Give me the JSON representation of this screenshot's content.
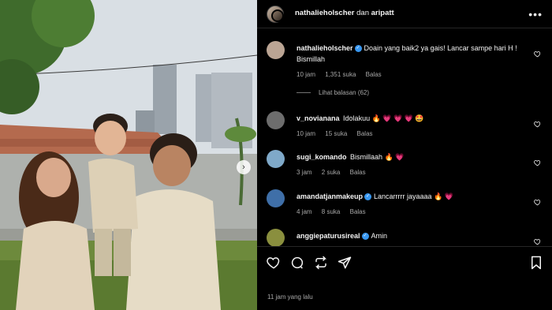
{
  "header": {
    "user1": "nathalieholscher",
    "connector": "dan",
    "user2": "aripatt",
    "more_icon": "more-horizontal-icon"
  },
  "photo": {
    "next_icon": "chevron-right-icon",
    "next_symbol": "›"
  },
  "comments": [
    {
      "username": "nathalieholscher",
      "verified": true,
      "text": "Doain yang baik2 ya gais! Lancar sampe hari H ! Bismillah",
      "time": "10 jam",
      "likes": "1,351 suka",
      "reply": "Balas",
      "avatar_color": "#bba594"
    },
    {
      "username": "v_novianana",
      "verified": false,
      "text": "Idolakuu 🔥 💗 💗 💗 🤩",
      "time": "10 jam",
      "likes": "15 suka",
      "reply": "Balas",
      "avatar_color": "#6d6d6d"
    },
    {
      "username": "sugi_komando",
      "verified": false,
      "text": "Bismillaah 🔥 💗",
      "time": "3 jam",
      "likes": "2 suka",
      "reply": "Balas",
      "avatar_color": "#7fa9c9"
    },
    {
      "username": "amandatjanmakeup",
      "verified": true,
      "text": "Lancarrrrr jayaaaa 🔥 💗",
      "time": "4 jam",
      "likes": "8 suka",
      "reply": "Balas",
      "avatar_color": "#3f6fa8"
    },
    {
      "username": "anggiepaturusireal",
      "verified": true,
      "text": "Amin",
      "time": "",
      "likes": "",
      "reply": "",
      "avatar_color": "#8a8f3e"
    }
  ],
  "view_replies": "Lihat balasan (62)",
  "actions": {
    "like_icon": "heart-icon",
    "comment_icon": "comment-icon",
    "repost_icon": "repost-icon",
    "share_icon": "share-icon",
    "save_icon": "bookmark-icon"
  },
  "timestamp": "11 jam yang lalu"
}
